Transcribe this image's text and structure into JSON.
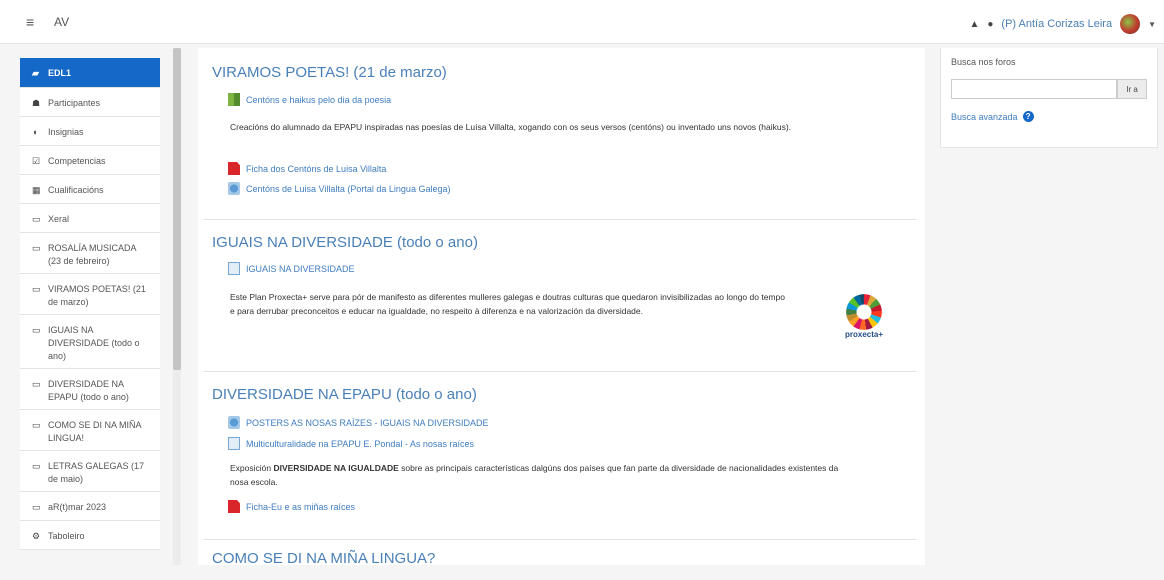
{
  "navbar": {
    "menu_icon": "hamburger-icon",
    "site_name": "AV",
    "notifications_icon": "bell-icon",
    "messages_icon": "chat-icon",
    "user_name": "(P) Antía Corizas Leira"
  },
  "drawer": {
    "items": [
      {
        "label": "EDL1",
        "icon": "graduation-cap-icon",
        "glyph": "≡"
      },
      {
        "label": "Participantes",
        "icon": "users-icon",
        "glyph": "👥"
      },
      {
        "label": "Insignias",
        "icon": "badge-icon",
        "glyph": "◐"
      },
      {
        "label": "Competencias",
        "icon": "checklist-icon",
        "glyph": "☑"
      },
      {
        "label": "Cualificacións",
        "icon": "table-icon",
        "glyph": "▦"
      },
      {
        "label": "Xeral",
        "icon": "folder-icon",
        "glyph": "▭"
      },
      {
        "label": "ROSALÍA MUSICADA (23 de febreiro)",
        "icon": "folder-icon",
        "glyph": "▭"
      },
      {
        "label": "VIRAMOS POETAS! (21 de marzo)",
        "icon": "folder-icon",
        "glyph": "▭"
      },
      {
        "label": "IGUAIS NA DIVERSIDADE (todo o ano)",
        "icon": "folder-icon",
        "glyph": "▭"
      },
      {
        "label": "DIVERSIDADE NA EPAPU (todo o ano)",
        "icon": "folder-icon",
        "glyph": "▭"
      },
      {
        "label": "COMO SE DI NA MIÑA LINGUA!",
        "icon": "folder-icon",
        "glyph": "▭"
      },
      {
        "label": "LETRAS GALEGAS (17 de maio)",
        "icon": "folder-icon",
        "glyph": "▭"
      },
      {
        "label": "aR(t)mar 2023",
        "icon": "folder-icon",
        "glyph": "▭"
      },
      {
        "label": "Taboleiro",
        "icon": "dashboard-icon",
        "glyph": "⚙"
      }
    ]
  },
  "sections": [
    {
      "title": "VIRAMOS POETAS! (21 de marzo)",
      "activities": [
        {
          "label": "Centóns e haikus pelo dia da poesia",
          "icon": "book-icon"
        },
        {
          "label": "Ficha dos Centóns de Luisa Villalta",
          "icon": "pdf-icon"
        },
        {
          "label": "Centóns de Luisa Villalta (Portal da Lingua Galega)",
          "icon": "url-icon"
        }
      ],
      "description": "Creacións do alumnado da EPAPU inspiradas nas poesías de Luísa Villalta, xogando con os seus versos (centóns) ou inventado uns novos (haikus)."
    },
    {
      "title": "IGUAIS NA DIVERSIDADE (todo o ano)",
      "activities": [
        {
          "label": "IGUAIS NA DIVERSIDADE",
          "icon": "page-icon"
        }
      ],
      "description_line1": "Este Plan Proxecta+ serve para pór de manifesto as diferentes mulleres galegas e doutras culturas que quedaron invisibilizadas ao longo do tempo",
      "description_line2": "e para derrubar preconceitos e educar na igualdade, no respeito à diferenza e na valorización da diversidade.",
      "logo_text": "proxecta+"
    },
    {
      "title": "DIVERSIDADE NA EPAPU (todo o ano)",
      "activities": [
        {
          "label": "POSTERS AS NOSAS RAÍZES - IGUAIS NA DIVERSIDADE",
          "icon": "url-icon"
        },
        {
          "label": "Multiculturalidade na EPAPU E. Pondal - As nosas raíces",
          "icon": "page-icon"
        },
        {
          "label": "Ficha-Eu e as miñas raíces",
          "icon": "pdf-icon"
        }
      ],
      "desc_pre": "Exposición ",
      "desc_bold": "DIVERSIDADE NA IGUALDADE",
      "desc_post": " sobre as principais características dalgúns dos países que fan parte da diversidade de nacionalidades existentes da",
      "desc_line2": "nosa escola."
    },
    {
      "title": "COMO SE DI NA MIÑA LINGUA?"
    }
  ],
  "forum_search": {
    "label": "Busca nos foros",
    "input_value": "",
    "button_label": "Ir a",
    "advanced_label": "Busca avanzada",
    "help_glyph": "?"
  }
}
